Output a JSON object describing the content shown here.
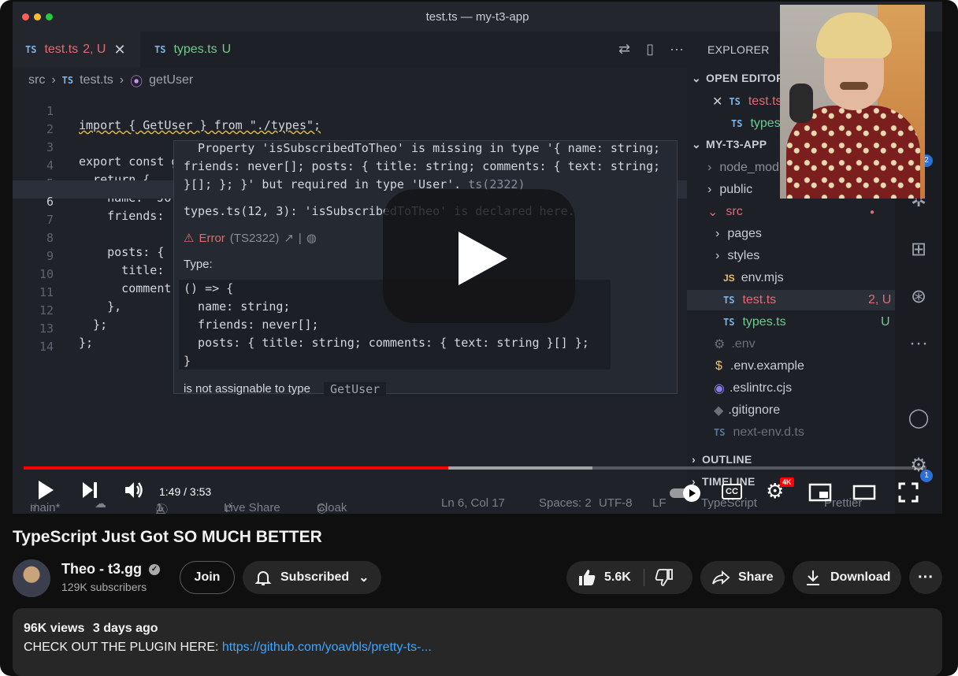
{
  "editor_window": {
    "title": "test.ts — my-t3-app",
    "tabs": [
      {
        "badge": "TS",
        "name": "test.ts",
        "status": "2, U"
      },
      {
        "badge": "TS",
        "name": "types.ts",
        "status": "U"
      }
    ],
    "breadcrumb": [
      "src",
      "test.ts",
      "getUser"
    ]
  },
  "code_lines": [
    {
      "n": "1",
      "text": "import { GetUser } from \"./types\";"
    },
    {
      "n": "2",
      "text": ""
    },
    {
      "n": "3",
      "text": "export const getUser: GetUser = () => {"
    },
    {
      "n": "4",
      "text": "  return {"
    },
    {
      "n": "5",
      "text": "    name: \"Jo"
    },
    {
      "n": "6",
      "text": "    friends:"
    },
    {
      "n": "7",
      "text": ""
    },
    {
      "n": "8",
      "text": "    posts: {"
    },
    {
      "n": "9",
      "text": "      title:"
    },
    {
      "n": "10",
      "text": "      comment"
    },
    {
      "n": "11",
      "text": "    },"
    },
    {
      "n": "12",
      "text": "  };"
    },
    {
      "n": "13",
      "text": "};"
    },
    {
      "n": "14",
      "text": ""
    }
  ],
  "hover": {
    "line1": "  Property 'isSubscribedToTheo' is missing in type '{ name: string;",
    "line2": "friends: never[]; posts: { title: string; comments: { text: string;",
    "line3": "}[]; }; }' but required in type 'User'.",
    "line3_code": "ts(2322)",
    "line4": "types.ts(12, 3): 'isSubscribedToTheo' is declared here.",
    "error_label": "Error",
    "error_code": "(TS2322)",
    "type_label": "Type:",
    "type_lines": [
      "() => {",
      "  name: string;",
      "  friends: never[];",
      "  posts: { title: string; comments: { text: string }[] };",
      "}"
    ],
    "assign_text": "is not assignable to type",
    "assign_type": "GetUser"
  },
  "explorer": {
    "header": "EXPLORER",
    "open_editors": "OPEN EDITORS",
    "open_files": [
      "test.ts",
      "types.ts"
    ],
    "project": "MY-T3-APP",
    "tree": [
      {
        "name": "node_modules",
        "kind": "folder"
      },
      {
        "name": "public",
        "kind": "folder"
      },
      {
        "name": "src",
        "kind": "folder-open"
      },
      {
        "name": "pages",
        "kind": "folder"
      },
      {
        "name": "styles",
        "kind": "folder"
      },
      {
        "name": "env.mjs",
        "kind": "js"
      },
      {
        "name": "test.ts",
        "kind": "ts",
        "status": "2, U"
      },
      {
        "name": "types.ts",
        "kind": "ts",
        "status": "U"
      },
      {
        "name": ".env",
        "kind": "gear"
      },
      {
        "name": ".env.example",
        "kind": "dollar"
      },
      {
        "name": ".eslintrc.cjs",
        "kind": "eslint"
      },
      {
        "name": ".gitignore",
        "kind": "git"
      },
      {
        "name": "next-env.d.ts",
        "kind": "ts"
      }
    ],
    "outline": "OUTLINE",
    "timeline": "TIMELINE",
    "source_control_badge": "2",
    "settings_badge": "1"
  },
  "statusbar": {
    "branch": "main*",
    "errors": "1",
    "warnings": "1",
    "live_share": "Live Share",
    "cloak": "Cloak",
    "position": "Ln 6, Col 17",
    "spaces": "Spaces: 2",
    "encoding": "UTF-8",
    "eol": "LF",
    "language": "TypeScript",
    "prettier": "Prettier"
  },
  "player": {
    "time_current": "1:49",
    "time_total": "3:53",
    "time_display": "1:49 / 3:53",
    "progress_played": 0.47,
    "progress_buffered": 0.63,
    "quality_badge": "4K",
    "cc_label": "CC"
  },
  "video": {
    "title": "TypeScript Just Got SO MUCH BETTER",
    "channel": "Theo - t3.gg",
    "subscribers": "129K subscribers",
    "join_label": "Join",
    "subscribed_label": "Subscribed",
    "likes": "5.6K",
    "share_label": "Share",
    "download_label": "Download",
    "views": "96K views",
    "posted": "3 days ago",
    "description_text": "CHECK OUT THE PLUGIN HERE: ",
    "description_link": "https://github.com/yoavbls/pretty-ts-..."
  },
  "colors": {
    "progress_red": "#ff0000",
    "link_blue": "#3ea6ff",
    "ts_red": "#e06c75",
    "ts_green": "#73c991"
  }
}
